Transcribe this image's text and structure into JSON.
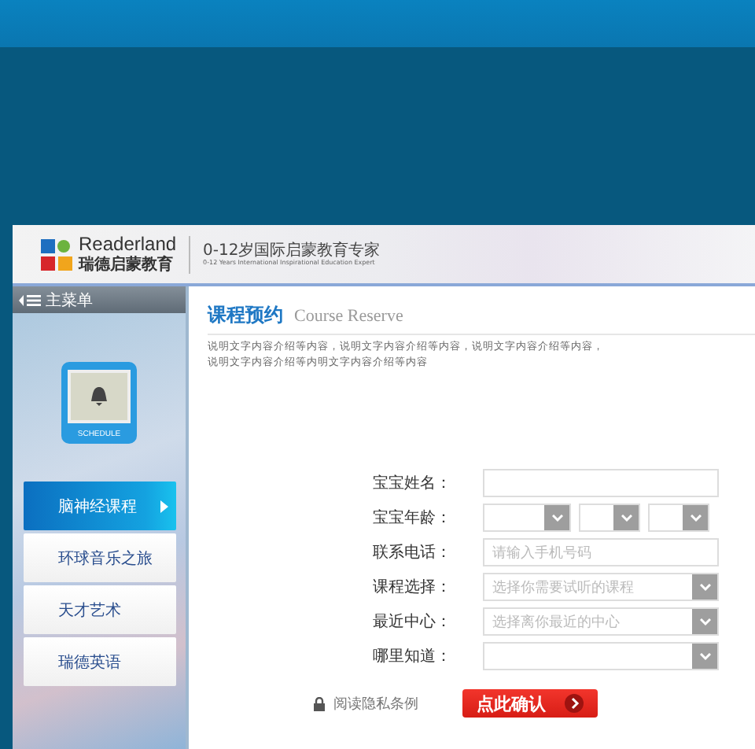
{
  "header": {
    "logo_name": "Readerland",
    "logo_cn": "瑞德启蒙教育",
    "slogan": "0-12岁国际启蒙教育专家",
    "slogan_en": "0-12 Years International Inspirational Education Expert"
  },
  "sidebar": {
    "menu_title": "主菜单",
    "badge": "SCHEDULE",
    "items": [
      {
        "label": "脑神经课程",
        "selected": true
      },
      {
        "label": "环球音乐之旅",
        "selected": false
      },
      {
        "label": "天才艺术",
        "selected": false
      },
      {
        "label": "瑞德英语",
        "selected": false
      }
    ]
  },
  "content": {
    "title": "课程预约",
    "title_en": "Course Reserve",
    "description": [
      "说明文字内容介绍等内容，说明文字内容介绍等内容，说明文字内容介绍等内容，",
      "说明文字内容介绍等内明文字内容介绍等内容"
    ]
  },
  "form": {
    "fields": [
      {
        "label": "宝宝姓名：",
        "kind": "text"
      },
      {
        "label": "宝宝年龄：",
        "kind": "triple_select"
      },
      {
        "label": "联系电话：",
        "kind": "text",
        "placeholder": "请输入手机号码"
      },
      {
        "label": "课程选择：",
        "kind": "select",
        "placeholder": "选择你需要试听的课程"
      },
      {
        "label": "最近中心：",
        "kind": "select",
        "placeholder": "选择离你最近的中心"
      },
      {
        "label": "哪里知道：",
        "kind": "select"
      }
    ],
    "privacy": "阅读隐私条例",
    "submit": "点此确认"
  }
}
